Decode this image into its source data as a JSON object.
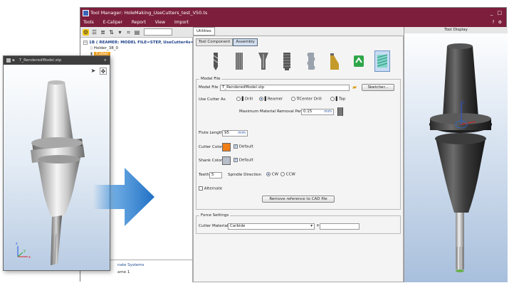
{
  "main_window": {
    "title": "Tool Manager: HoleMaking_UseCutters_test_V50.ts",
    "controls": [
      "_",
      "□"
    ],
    "help_icons": [
      "?",
      "⚙"
    ],
    "menu": [
      "Tools",
      "E-Caliper",
      "Report",
      "View",
      "Import"
    ]
  },
  "tree": {
    "root_label": "1B ( REAMER: MODEL FILE=STEP, UseCutter4s=",
    "holder_label": "Holder_38_0",
    "cutter_label": "Cutter"
  },
  "bottom_panel": {
    "row1": "nate Systems",
    "row2": "ame 1"
  },
  "center": {
    "tabs": [
      "Utilities"
    ],
    "subtabs": [
      "Tool Component",
      "Assembly"
    ],
    "tool_types": [
      "drill-cutter",
      "reamer-cutter",
      "center-drill-cutter",
      "tap-cutter",
      "form-cutter",
      "insert-cutter",
      "swap-cutter",
      "mill-cutter"
    ],
    "model_file": {
      "legend": "Model File",
      "label": "Model File",
      "value": "T_RenderedModel.stp",
      "sketcher_button": "Sketcher...",
      "use_cutter_as": "Use Cutter As",
      "options": [
        "Drill",
        "Reamer",
        "Center Drill",
        "Tap"
      ],
      "selected": "Reamer",
      "max_removal_label": "Maximum Material Removal Per Side",
      "max_removal_value": "0.15",
      "max_removal_unit": "mm",
      "flute_length_label": "Flute Length",
      "flute_length_value": "95",
      "flute_length_unit": "mm",
      "cutter_color_label": "Cutter Color",
      "cutter_color_default": "Default",
      "shank_color_label": "Shank Color",
      "shank_color_default": "Default",
      "teeth_label": "Teeth",
      "teeth_value": "5",
      "spindle_direction_label": "Spindle Direction",
      "spindle_cw": "CW",
      "spindle_ccw": "CCW",
      "alternate_label": "Alternate",
      "remove_button": "Remove reference to CAD file"
    },
    "force_settings": {
      "legend": "Force Settings",
      "material_label": "Cutter Material",
      "material_value": "Carbide"
    }
  },
  "display": {
    "title": "Tool Display"
  },
  "float_window": {
    "title": "T_RenderedModel.stp"
  },
  "axes": {
    "x": "x",
    "y": "y",
    "z": "z"
  },
  "colors": {
    "title_bar": "#7d1f3c",
    "cutter_color": "#f07d16",
    "shank_color": "#b7bec8",
    "arrow": "#2f86d6",
    "tree_highlight": "#f3a21c"
  }
}
